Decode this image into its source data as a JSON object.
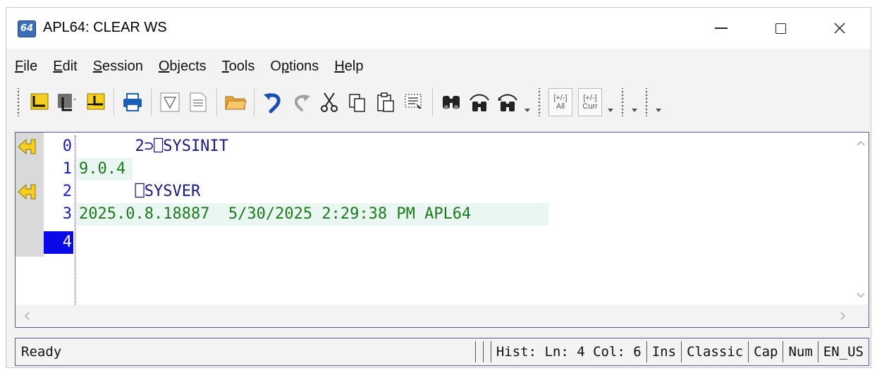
{
  "window": {
    "title": "APL64: CLEAR WS",
    "app_icon_text": "64",
    "controls": [
      "minimize",
      "maximize",
      "close"
    ]
  },
  "menu": {
    "items": [
      {
        "label": "File",
        "accel": "F"
      },
      {
        "label": "Edit",
        "accel": "E"
      },
      {
        "label": "Session",
        "accel": "S"
      },
      {
        "label": "Objects",
        "accel": "O"
      },
      {
        "label": "Tools",
        "accel": "T"
      },
      {
        "label": "Options",
        "accel": "p"
      },
      {
        "label": "Help",
        "accel": "H"
      }
    ]
  },
  "toolbar": {
    "buttons": [
      "new-session-icon",
      "new-fn-icon",
      "open-editor-icon",
      "print-icon",
      "filter-icon",
      "document-icon",
      "open-folder-icon",
      "undo-icon",
      "redo-icon",
      "cut-icon",
      "copy-icon",
      "paste-icon",
      "select-all-icon",
      "find-icon",
      "find-previous-icon",
      "find-next-icon"
    ],
    "expand_all_top": "[+/-]",
    "expand_all_bottom": "All",
    "expand_curr_top": "[+/-]",
    "expand_curr_bottom": "Curr",
    "colors": {
      "yellow": "#f5d020",
      "blue": "#1a5fb4",
      "grey": "#707070"
    }
  },
  "session": {
    "lines": [
      {
        "num": "0",
        "text": "      2⊃⎕SYSINIT",
        "kind": "input",
        "marker": true
      },
      {
        "num": "1",
        "text": "9.0.4",
        "kind": "output",
        "marker": false
      },
      {
        "num": "2",
        "text": "      ⎕SYSVER",
        "kind": "input",
        "marker": true
      },
      {
        "num": "3",
        "text": "2025.0.8.18887  5/30/2025 2:29:38 PM APL64",
        "kind": "output",
        "marker": false
      },
      {
        "num": "4",
        "text": "",
        "kind": "current",
        "marker": false
      }
    ],
    "colors": {
      "input": "#1a1a7a",
      "output": "#1e7a1e",
      "line_number": "#1a1ab8",
      "current_line_bg": "#0a0ae8"
    }
  },
  "status": {
    "ready": "Ready",
    "hist": "Hist: Ln: 4 Col: 6",
    "mode": "Ins",
    "keyboard": "Classic",
    "caps": "Cap",
    "num": "Num",
    "locale": "EN_US"
  }
}
